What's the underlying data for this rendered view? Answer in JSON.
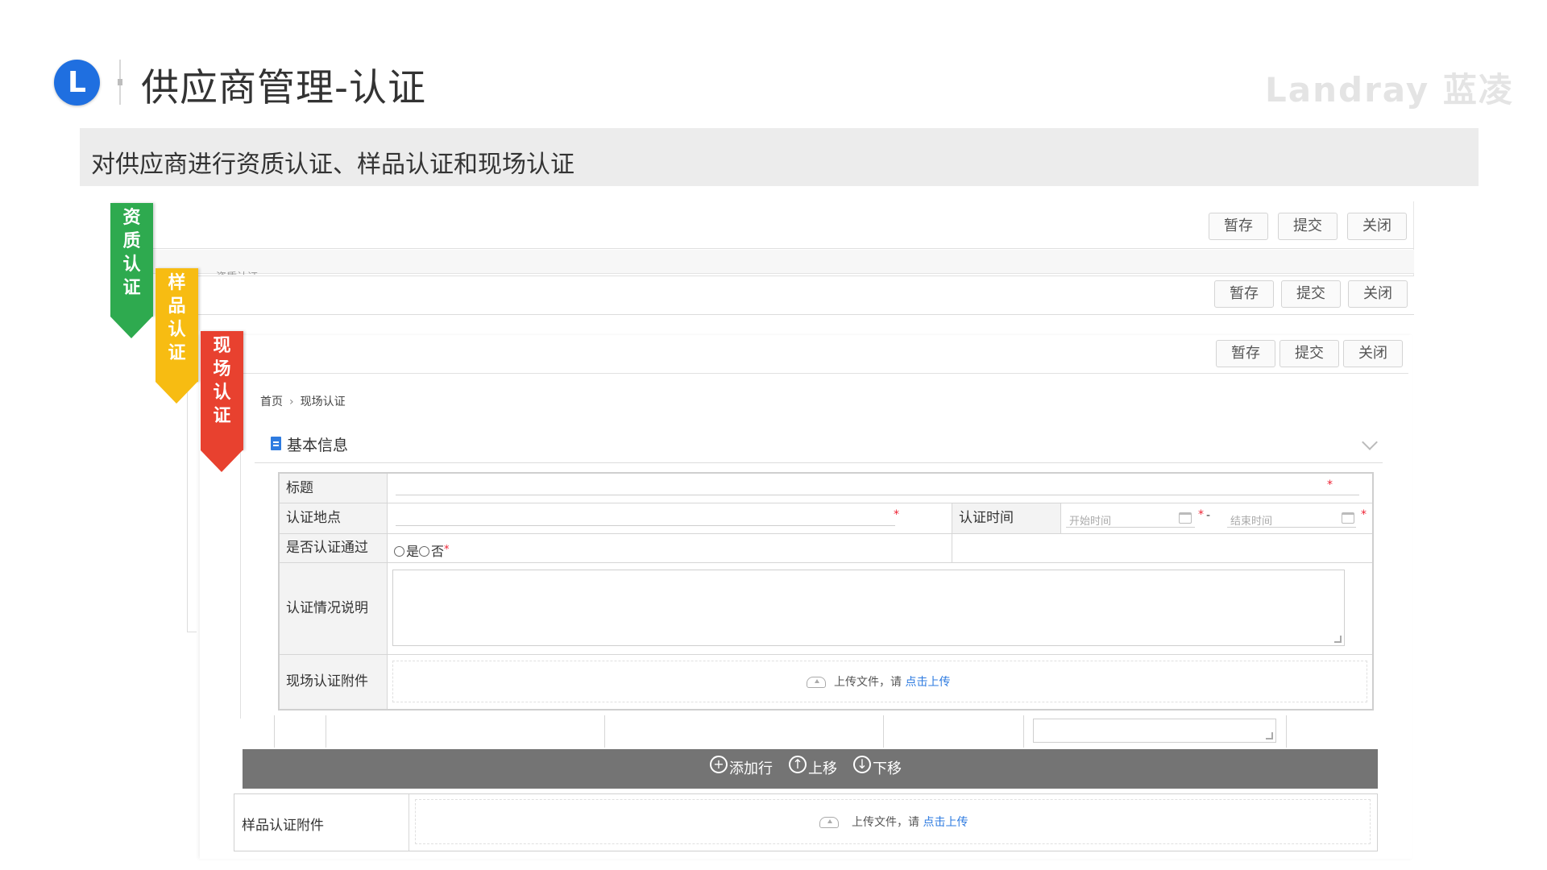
{
  "header": {
    "logo_letter": "L",
    "title": "供应商管理-认证",
    "brand": "Landray 蓝凌"
  },
  "banner": {
    "text": "对供应商进行资质认证、样品认证和现场认证"
  },
  "ribbons": [
    {
      "label": "资质认证",
      "color": "#2eaa4f"
    },
    {
      "label": "样品认证",
      "color": "#f7bc12"
    },
    {
      "label": "现场认证",
      "color": "#e8412f"
    }
  ],
  "windows": [
    {
      "save": "暂存",
      "submit": "提交",
      "close": "关闭"
    },
    {
      "save": "暂存",
      "submit": "提交",
      "close": "关闭"
    },
    {
      "save": "暂存",
      "submit": "提交",
      "close": "关闭"
    }
  ],
  "window1_strip_text": "资质认证",
  "breadcrumb": {
    "home": "首页",
    "current": "现场认证"
  },
  "section": {
    "title": "基本信息"
  },
  "form": {
    "title_label": "标题",
    "location_label": "认证地点",
    "time_label": "认证时间",
    "start_placeholder": "开始时间",
    "end_placeholder": "结束时间",
    "passed_label": "是否认证通过",
    "yes": "是",
    "no": "否",
    "desc_label": "认证情况说明",
    "attach_label": "现场认证附件",
    "upload_text": "上传文件，请 ",
    "upload_link": "点击上传"
  },
  "lower_toolbar": {
    "add_row": "添加行",
    "move_up": "上移",
    "move_down": "下移"
  },
  "sample": {
    "label": "样品认证附件",
    "upload_text": "上传文件，请 ",
    "upload_link": "点击上传"
  },
  "colors": {
    "accent_blue": "#1f6fe0",
    "link": "#2e7be0",
    "required": "#e23"
  }
}
